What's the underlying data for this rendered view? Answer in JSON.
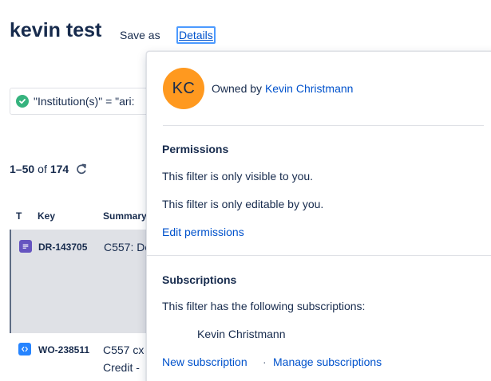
{
  "header": {
    "title": "kevin test",
    "save_as": "Save as",
    "details": "Details"
  },
  "jql": {
    "text": "\"Institution(s)\" = \"ari:"
  },
  "results": {
    "range": "1–50",
    "of": "of",
    "total": "174"
  },
  "table": {
    "columns": [
      "T",
      "Key",
      "Summary"
    ],
    "rows": [
      {
        "key": "DR-143705",
        "summary": "C557: De",
        "type_icon": "document-icon",
        "selected": true
      },
      {
        "key": "WO-238511",
        "summary_line1": "C557 cx",
        "summary_line2": "Credit -",
        "type_icon": "code-icon",
        "selected": false
      }
    ]
  },
  "details_popup": {
    "avatar_initials": "KC",
    "owned_by_label": "Owned by",
    "owner_name": "Kevin Christmann",
    "permissions": {
      "title": "Permissions",
      "visible_text": "This filter is only visible to you.",
      "editable_text": "This filter is only editable by you.",
      "edit_link": "Edit permissions"
    },
    "subscriptions": {
      "title": "Subscriptions",
      "intro_text": "This filter has the following subscriptions:",
      "subscriber": "Kevin Christmann",
      "new_link": "New subscription",
      "separator": "·",
      "manage_link": "Manage subscriptions"
    }
  },
  "colors": {
    "link": "#0052cc",
    "avatar": "#ff991f",
    "success": "#36b37e",
    "selected_row": "#dfe1e6",
    "story_icon": "#6554c0",
    "task_icon": "#2684ff"
  }
}
